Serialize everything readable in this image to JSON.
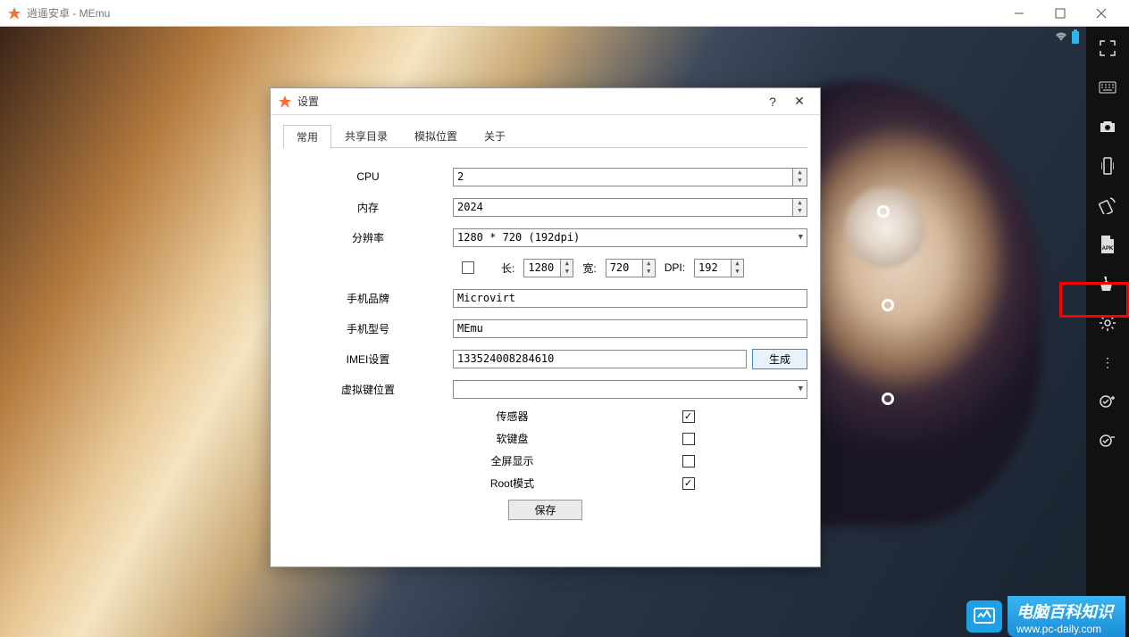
{
  "window": {
    "title": "逍遥安卓 - MEmu"
  },
  "dialog": {
    "title": "设置",
    "help": "?",
    "close": "✕",
    "tabs": [
      "常用",
      "共享目录",
      "模拟位置",
      "关于"
    ],
    "labels": {
      "cpu": "CPU",
      "memory": "内存",
      "resolution": "分辨率",
      "length": "长:",
      "width": "宽:",
      "dpi": "DPI:",
      "brand": "手机品牌",
      "model": "手机型号",
      "imei": "IMEI设置",
      "vkey": "虚拟键位置",
      "sensor": "传感器",
      "softkb": "软键盘",
      "fullscreen": "全屏显示",
      "root": "Root模式"
    },
    "values": {
      "cpu": "2",
      "memory": "2024",
      "resolution": "1280 * 720 (192dpi)",
      "length": "1280",
      "width": "720",
      "dpi": "192",
      "brand": "Microvirt",
      "model": "MEmu",
      "imei": "133524008284610",
      "vkey": ""
    },
    "checks": {
      "sensor": true,
      "softkb": false,
      "fullscreen": false,
      "root": true
    },
    "buttons": {
      "generate": "生成",
      "save": "保存"
    }
  },
  "watermark": {
    "text": "电脑百科知识",
    "url": "www.pc-daily.com"
  }
}
